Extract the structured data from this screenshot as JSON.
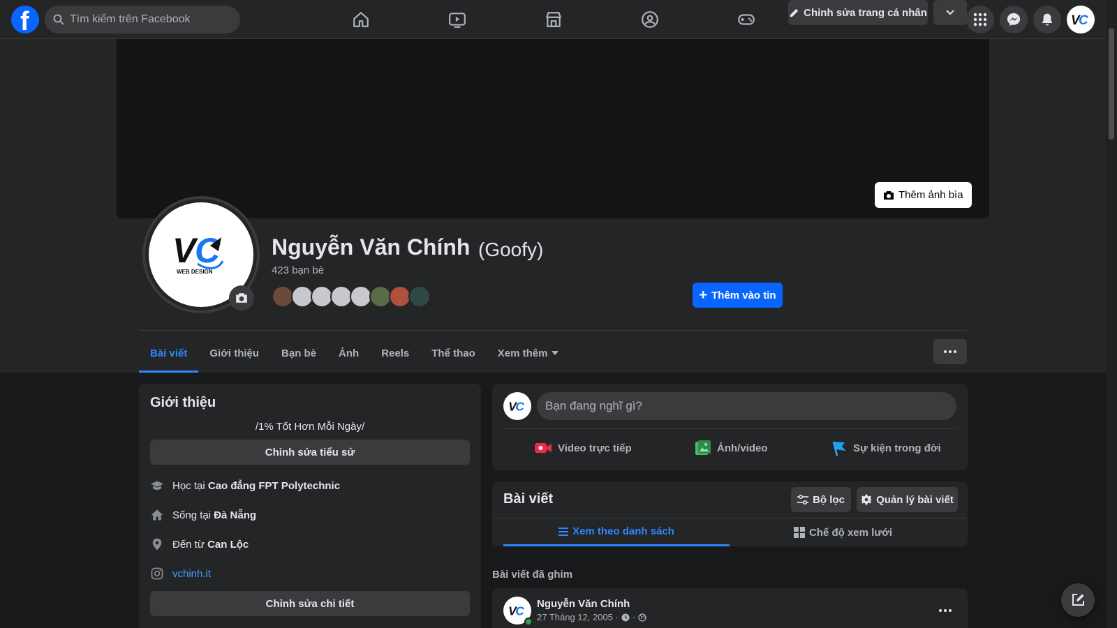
{
  "colors": {
    "accent": "#0866ff",
    "link": "#2d88ff",
    "online": "#31a24c",
    "background": "#18191a",
    "surface": "#242526"
  },
  "topbar": {
    "search_placeholder": "Tìm kiếm trên Facebook",
    "nav_icons": [
      "home-icon",
      "video-icon",
      "marketplace-icon",
      "groups-icon",
      "gaming-icon"
    ],
    "right_icons": [
      "menu-grid-icon",
      "messenger-icon",
      "bell-icon"
    ]
  },
  "profile": {
    "name": "Nguyễn Văn Chính",
    "nickname": "(Goofy)",
    "friends_count": "423 bạn bè",
    "add_cover": "Thêm ảnh bìa",
    "add_story": "Thêm vào tin",
    "edit_profile": "Chỉnh sửa trang cá nhân"
  },
  "tabs": [
    {
      "label": "Bài viết",
      "active": true
    },
    {
      "label": "Giới thiệu"
    },
    {
      "label": "Bạn bè"
    },
    {
      "label": "Ảnh"
    },
    {
      "label": "Reels"
    },
    {
      "label": "Thể thao"
    },
    {
      "label": "Xem thêm"
    }
  ],
  "intro": {
    "title": "Giới thiệu",
    "bio": "/1% Tốt Hơn Mỗi Ngày/",
    "edit_bio": "Chỉnh sửa tiểu sử",
    "study_prefix": "Học tại ",
    "study_place": "Cao đẳng FPT Polytechnic",
    "live_prefix": "Sống tại ",
    "live_place": "Đà Nẵng",
    "from_prefix": "Đến từ ",
    "from_place": "Can Lộc",
    "instagram": "vchinh.it",
    "edit_details": "Chỉnh sửa chi tiết"
  },
  "composer": {
    "placeholder": "Bạn đang nghĩ gì?",
    "live_video": "Video trực tiếp",
    "photo_video": "Ảnh/video",
    "life_event": "Sự kiện trong đời"
  },
  "posts": {
    "title": "Bài viết",
    "filter": "Bộ lọc",
    "manage": "Quản lý bài viết",
    "list_view": "Xem theo danh sách",
    "grid_view": "Chế độ xem lưới",
    "pinned_label": "Bài viết đã ghim",
    "post_author": "Nguyễn Văn Chính",
    "post_date": "27 Tháng 12, 2005 ·",
    "post_sep": "·"
  }
}
